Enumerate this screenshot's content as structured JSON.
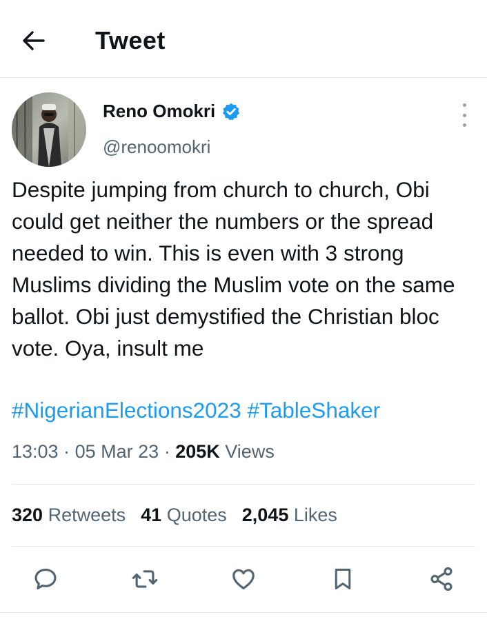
{
  "header": {
    "title": "Tweet"
  },
  "author": {
    "name": "Reno Omokri",
    "handle": "@renoomokri"
  },
  "tweet": {
    "text": "Despite jumping from church to church, Obi could get neither the numbers or the spread needed to win. This is even with 3 strong Muslims dividing the Muslim vote on the same ballot. Obi just demystified the Christian bloc vote. Oya, insult me",
    "hashtags": [
      "#NigerianElections2023",
      "#TableShaker"
    ]
  },
  "meta": {
    "time": "13:03",
    "date": "05 Mar 23",
    "views_count": "205K",
    "views_label": "Views",
    "separator": "·"
  },
  "stats": [
    {
      "count": "320",
      "label": "Retweets"
    },
    {
      "count": "41",
      "label": "Quotes"
    },
    {
      "count": "2,045",
      "label": "Likes"
    }
  ],
  "colors": {
    "accent": "#1d9bf0",
    "text": "#0f1419",
    "muted": "#536471",
    "divider": "#e6e9eb"
  },
  "icons": {
    "back": "arrow-left-icon",
    "verified": "verified-badge-icon",
    "more": "more-vertical-icon",
    "reply": "reply-icon",
    "retweet": "retweet-icon",
    "like": "heart-icon",
    "bookmark": "bookmark-icon",
    "share": "share-icon"
  }
}
